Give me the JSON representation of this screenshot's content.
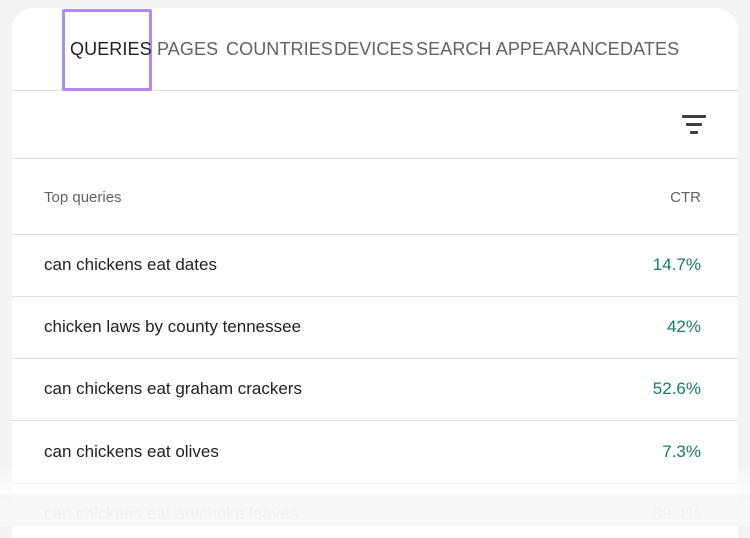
{
  "tabs": [
    {
      "label": "QUERIES",
      "active": true
    },
    {
      "label": "PAGES",
      "active": false
    },
    {
      "label": "COUNTRIES",
      "active": false
    },
    {
      "label": "DEVICES",
      "active": false
    },
    {
      "label": "SEARCH APPEARANCE",
      "active": false
    },
    {
      "label": "DATES",
      "active": false
    }
  ],
  "toolbar": {
    "filter_icon": "filter-icon"
  },
  "table": {
    "header": {
      "query": "Top queries",
      "ctr": "CTR"
    },
    "rows": [
      {
        "query": "can chickens eat dates",
        "ctr": "14.7%"
      },
      {
        "query": "chicken laws by county tennessee",
        "ctr": "42%"
      },
      {
        "query": "can chickens eat graham crackers",
        "ctr": "52.6%"
      },
      {
        "query": "can chickens eat olives",
        "ctr": "7.3%"
      },
      {
        "query": "can chickens eat artichoke leaves",
        "ctr": "39.4%"
      }
    ]
  },
  "colors": {
    "ctr": "#137d68",
    "highlight": "#b388f0"
  }
}
